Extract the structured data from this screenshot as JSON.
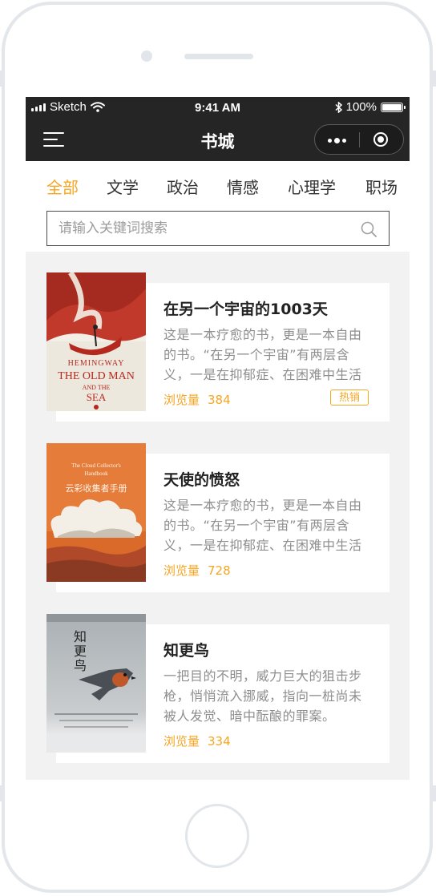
{
  "status_bar": {
    "carrier": "Sketch",
    "time": "9:41 AM",
    "battery": "100%"
  },
  "nav": {
    "title": "书城",
    "menu_icon": "hamburger-menu-icon",
    "more_icon": "more-dots-icon",
    "close_icon": "target-circle-icon"
  },
  "tabs": [
    {
      "label": "全部",
      "active": true
    },
    {
      "label": "文学",
      "active": false
    },
    {
      "label": "政治",
      "active": false
    },
    {
      "label": "情感",
      "active": false
    },
    {
      "label": "心理学",
      "active": false
    },
    {
      "label": "职场",
      "active": false
    }
  ],
  "search": {
    "placeholder": "请输入关键词搜索",
    "icon": "search-icon"
  },
  "views_label": "浏览量",
  "books": [
    {
      "title": "在另一个宇宙的1003天",
      "description": "这是一本疗愈的书，更是一本自由的书。“在另一个宇宙”有两层含义，一是在抑郁症、在困难中生活",
      "views": "384",
      "badge": "热销",
      "cover": {
        "lines": [
          "HEMINGWAY",
          "THE OLD MAN",
          "AND THE",
          "SEA"
        ],
        "colors": {
          "bg": "#c0392b",
          "paper": "#ece8de"
        }
      }
    },
    {
      "title": "天使的愤怒",
      "description": "这是一本疗愈的书，更是一本自由的书。“在另一个宇宙”有两层含义，一是在抑郁症、在困难中生活",
      "views": "728",
      "badge": "",
      "cover": {
        "lines": [
          "The Cloud Collector's",
          "Handbook",
          "云彩收集者手册"
        ],
        "colors": {
          "bg": "#e67c3a",
          "cloud": "#f4efe6"
        }
      }
    },
    {
      "title": "知更鸟",
      "description": "一把目的不明，威力巨大的狙击步枪，悄悄流入挪威，指向一桩尚未被人发觉、暗中酝酿的罪案。",
      "views": "334",
      "badge": "",
      "cover": {
        "lines": [
          "知",
          "更",
          "鸟"
        ],
        "colors": {
          "bg": "#9aa0a6",
          "bird": "#c0582a"
        }
      }
    }
  ],
  "colors": {
    "accent": "#f5a623",
    "nav_bg": "#252525",
    "list_bg": "#f2f2f2"
  }
}
